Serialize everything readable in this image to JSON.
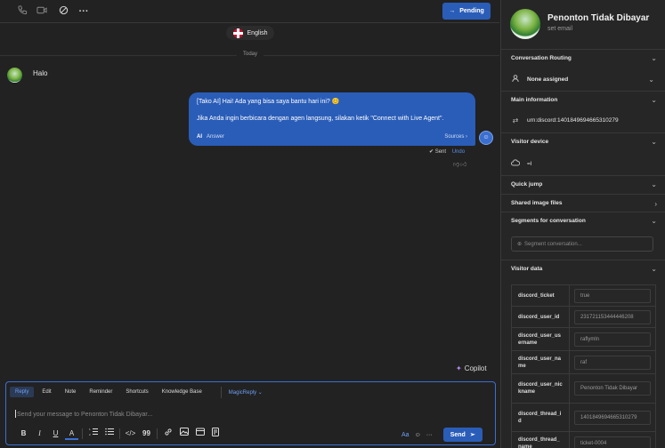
{
  "topbar": {
    "icons": [
      "phone-icon",
      "video-icon",
      "block-icon",
      "more-icon"
    ],
    "pending_label": "Pending"
  },
  "conversation": {
    "language": "English",
    "day_label": "Today",
    "incoming_message": "Halo",
    "outgoing": {
      "line1": "[Tako AI] Hai! Ada yang bisa saya bantu hari ini? 😊",
      "line2": "Jika Anda ingin berbicara dengan agen langsung, silakan ketik \"Connect with Live Agent\".",
      "badge": "AI",
      "answer_label": "Answer",
      "sources_label": "Sources ›"
    },
    "status": "✔ Sent",
    "undo_label": "Undo"
  },
  "copilot_label": "Copilot",
  "composer": {
    "tabs": [
      "Reply",
      "Edit",
      "Note",
      "Reminder",
      "Shortcuts",
      "Knowledge Base"
    ],
    "magic_reply": "MagicReply ⌄",
    "placeholder": "Send your message to Penonton Tidak Dibayar...",
    "send_label": "Send",
    "font_toggle": "Aa"
  },
  "profile": {
    "name": "Penonton Tidak Dibayar",
    "email_placeholder": "set email"
  },
  "sidebar": {
    "conversation_routing": "Conversation Routing",
    "assignee": "None assigned",
    "main_information": "Main information",
    "urn": "urn:discord:1401849694665310279",
    "visitor_device": "Visitor device",
    "device_value": "=l",
    "quick_jump": "Quick jump",
    "shared_image_files": "Shared image files",
    "segments": "Segments for conversation",
    "segment_placeholder": "Segment conversation...",
    "visitor_data": "Visitor data",
    "visitor_rows": [
      {
        "key": "discord_ticket",
        "value": "true"
      },
      {
        "key": "discord_user_id",
        "value": "231721153444446208"
      },
      {
        "key": "discord_user_username",
        "value": "raflymln"
      },
      {
        "key": "discord_user_name",
        "value": "raf"
      },
      {
        "key": "discord_user_nickname",
        "value": "Penonton Tidak Dibayar"
      },
      {
        "key": "discord_thread_id",
        "value": "1401849694665310279"
      },
      {
        "key": "discord_thread_name",
        "value": "ticket-0004"
      }
    ]
  },
  "colors": {
    "accent": "#2a5db8",
    "background": "#222222",
    "panel": "#262626"
  }
}
